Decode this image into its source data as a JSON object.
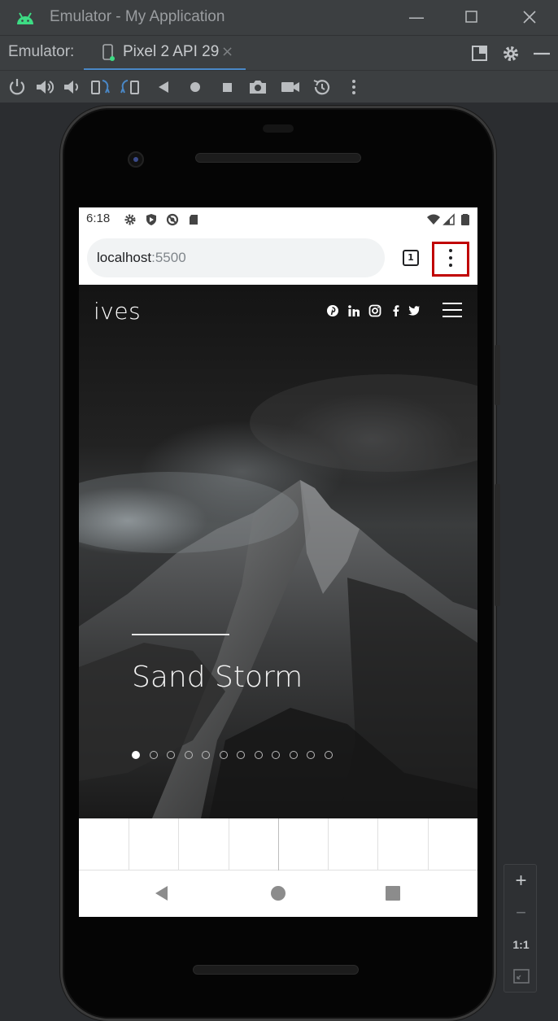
{
  "window": {
    "title": "Emulator - My Application",
    "icon": "android-icon"
  },
  "tabbar": {
    "label": "Emulator:",
    "tab_name": "Pixel 2 API 29",
    "close_symbol": "×"
  },
  "toolbar": {
    "icons": [
      "power-icon",
      "volume-up-icon",
      "volume-down-icon",
      "rotate-left-icon",
      "rotate-right-icon",
      "back-icon",
      "home-icon",
      "overview-icon",
      "screenshot-icon",
      "screenrecord-icon",
      "snapshot-icon",
      "more-icon"
    ]
  },
  "phone": {
    "status": {
      "time": "6:18"
    },
    "browser": {
      "host": "localhost",
      "port": ":5500",
      "tab_count": "1"
    },
    "site": {
      "brand": "ives",
      "social": [
        "pinterest-icon",
        "linkedin-icon",
        "instagram-icon",
        "facebook-icon",
        "twitter-icon"
      ],
      "slide_title": "Sand Storm",
      "slides_total": 12,
      "active_slide": 1
    }
  },
  "zoom": {
    "zoom_in": "+",
    "zoom_out": "−",
    "actual": "1:1"
  },
  "colors": {
    "highlight": "#c00000",
    "tab_underline": "#4a88c7",
    "android_green": "#3ddc84"
  }
}
